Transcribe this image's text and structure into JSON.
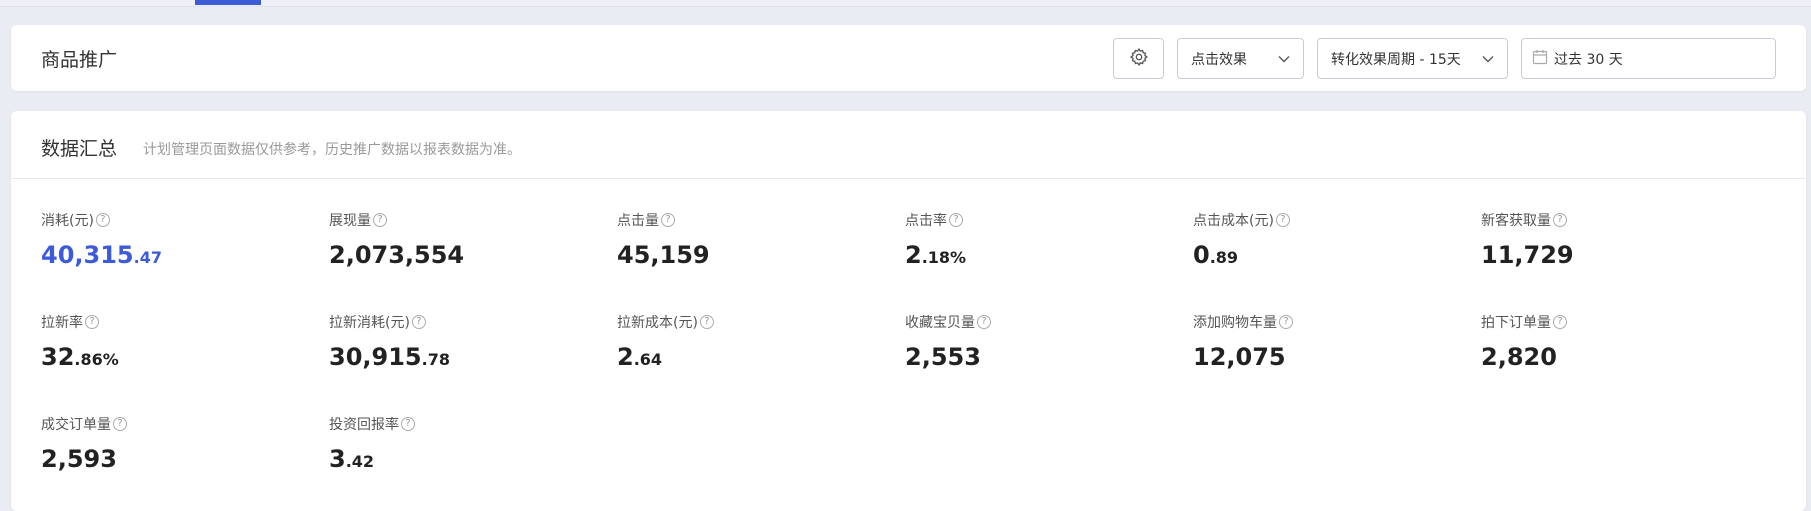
{
  "header": {
    "title": "商品推广",
    "settings_icon": "gear-icon",
    "click_effect_select": "点击效果",
    "period_select": "转化效果周期 - 15天",
    "date_range": "过去 30 天"
  },
  "summary": {
    "title": "数据汇总",
    "note": "计划管理页面数据仅供参考，历史推广数据以报表数据为准。",
    "metrics": [
      {
        "label": "消耗(元)",
        "main": "40,315",
        "dec": ".47",
        "accent": true
      },
      {
        "label": "展现量",
        "main": "2,073,554",
        "dec": ""
      },
      {
        "label": "点击量",
        "main": "45,159",
        "dec": ""
      },
      {
        "label": "点击率",
        "main": "2",
        "dec": ".18%"
      },
      {
        "label": "点击成本(元)",
        "main": "0",
        "dec": ".89"
      },
      {
        "label": "新客获取量",
        "main": "11,729",
        "dec": ""
      },
      {
        "label": "拉新率",
        "main": "32",
        "dec": ".86%"
      },
      {
        "label": "拉新消耗(元)",
        "main": "30,915",
        "dec": ".78"
      },
      {
        "label": "拉新成本(元)",
        "main": "2",
        "dec": ".64"
      },
      {
        "label": "收藏宝贝量",
        "main": "2,553",
        "dec": ""
      },
      {
        "label": "添加购物车量",
        "main": "12,075",
        "dec": ""
      },
      {
        "label": "拍下订单量",
        "main": "2,820",
        "dec": ""
      },
      {
        "label": "成交订单量",
        "main": "2,593",
        "dec": ""
      },
      {
        "label": "投资回报率",
        "main": "3",
        "dec": ".42"
      }
    ]
  },
  "colors": {
    "accent": "#3d5bd9",
    "background": "#eaecf3"
  }
}
